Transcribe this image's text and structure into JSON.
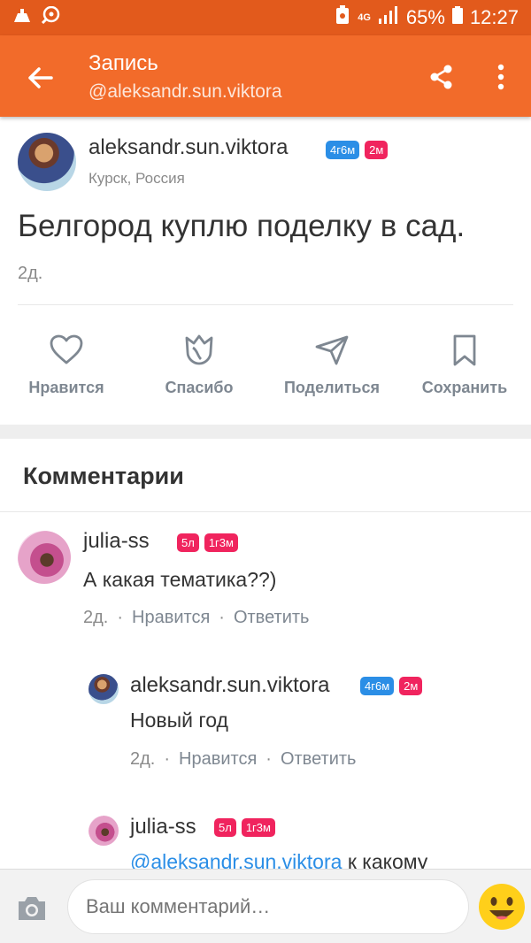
{
  "status_bar": {
    "network": "4G",
    "battery": "65%",
    "time": "12:27"
  },
  "app_bar": {
    "title": "Запись",
    "subtitle": "@aleksandr.sun.viktora"
  },
  "post": {
    "author": "aleksandr.sun.viktora",
    "badges": [
      "4г6м",
      "2м"
    ],
    "location": "Курск, Россия",
    "text": "Белгород куплю поделку в сад.",
    "time": "2д."
  },
  "actions": [
    {
      "label": "Нравится",
      "icon": "heart-icon"
    },
    {
      "label": "Спасибо",
      "icon": "tulip-icon"
    },
    {
      "label": "Поделиться",
      "icon": "send-icon"
    },
    {
      "label": "Сохранить",
      "icon": "bookmark-icon"
    }
  ],
  "comments_title": "Комментарии",
  "comments": [
    {
      "author": "julia-ss",
      "badges": [
        "5л",
        "1г3м"
      ],
      "text": "А какая тематика??)",
      "time": "2д.",
      "like": "Нравится",
      "reply": "Ответить"
    },
    {
      "author": "aleksandr.sun.viktora",
      "badges": [
        "4г6м",
        "2м"
      ],
      "text": "Новый год",
      "time": "2д.",
      "like": "Нравится",
      "reply": "Ответить"
    },
    {
      "author": "julia-ss",
      "badges": [
        "5л",
        "1г3м"
      ],
      "mention": "@aleksandr.sun.viktora",
      "text": "к какому"
    }
  ],
  "comment_input": {
    "placeholder": "Ваш комментарий…"
  },
  "colors": {
    "status_bar": "#e25a1c",
    "app_bar": "#f26b2a",
    "badge_blue": "#2b8ee6",
    "badge_pink": "#f0245e"
  }
}
